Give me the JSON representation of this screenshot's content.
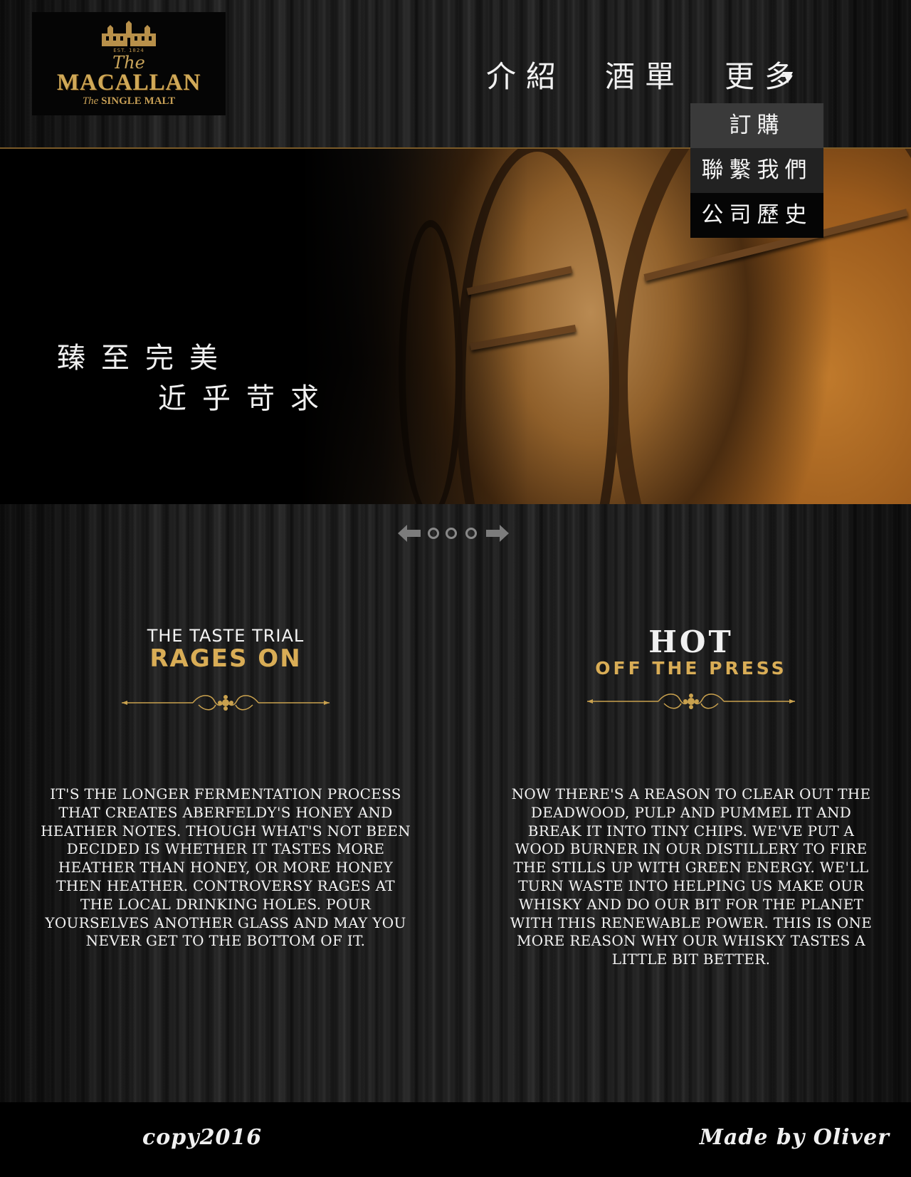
{
  "logo": {
    "est": "EST. 1824",
    "the": "The",
    "name": "MACALLAN",
    "tagline_the": "The",
    "tagline": " SINGLE MALT"
  },
  "nav": {
    "items": [
      "介紹",
      "酒單",
      "更多"
    ],
    "dropdown": [
      "訂購",
      "聯繫我們",
      "公司歷史"
    ]
  },
  "hero": {
    "line1": "臻至完美",
    "line2": "近乎苛求"
  },
  "sections": {
    "left": {
      "heading_small": "THE TASTE TRIAL",
      "heading_big": "RAGES ON",
      "body": "It's the longer fermentation process that creates Aberfeldy's honey and heather notes. Though what's not been decided is whether it tastes more heather than honey, or more honey then heather. Controversy rages at the local drinking holes. Pour yourselves another glass and may you never get to the bottom of it."
    },
    "right": {
      "heading_big": "HOT",
      "heading_small": "OFF THE PRESS",
      "body": "Now there's a reason to clear out the deadwood, pulp and pummel it and break it into tiny chips. We've put a wood burner in our distillery to fire the stills up with green energy. We'll turn waste into helping us make our whisky and do our bit for the planet with this renewable power. This is one more reason why our whisky tastes a little bit better."
    }
  },
  "footer": {
    "copyright": "copy2016",
    "author": "Made by Oliver"
  },
  "colors": {
    "gold": "#d9ad56",
    "logo_gold": "#d0a958",
    "dropdown_active": "#3a3a3a",
    "footer_bg": "#000000"
  },
  "icons": [
    "arrow-left-icon",
    "slide-dot-icon",
    "arrow-right-icon",
    "flourish-ornament"
  ]
}
